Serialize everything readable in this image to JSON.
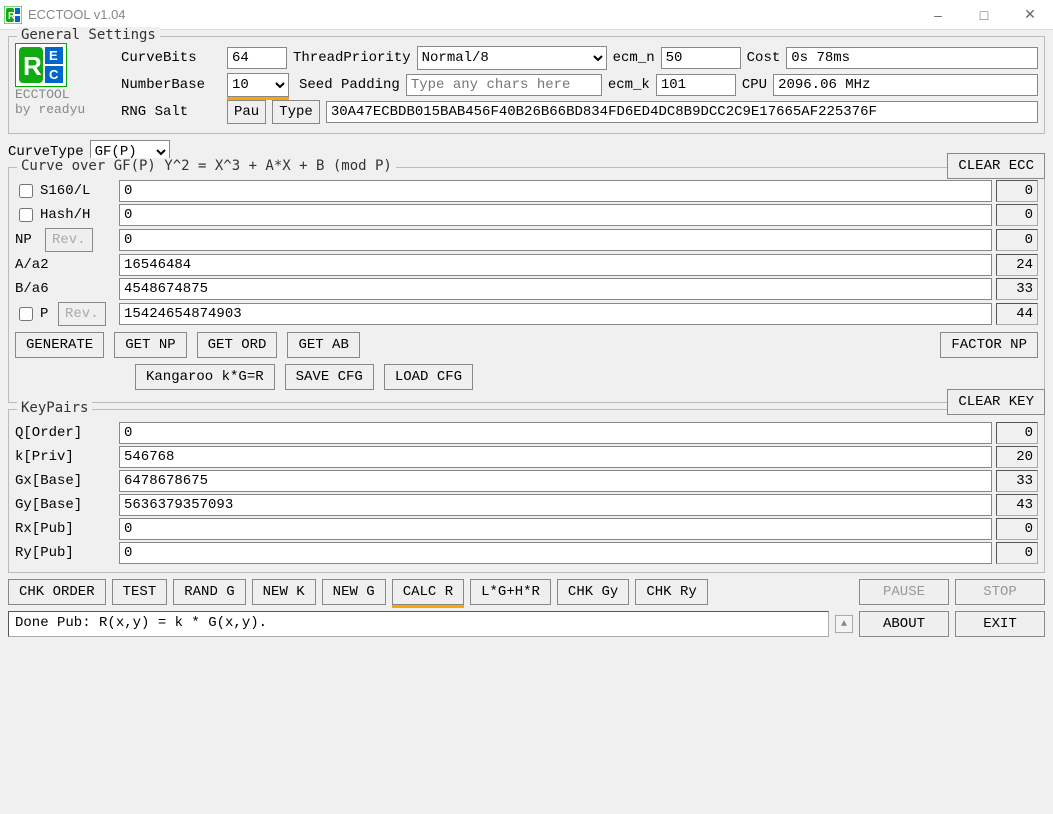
{
  "window": {
    "title": "ECCTOOL v1.04"
  },
  "logo": {
    "name": "ECCTOOL",
    "author": "by readyu"
  },
  "general": {
    "legend": "General Settings",
    "curvebits_label": "CurveBits",
    "curvebits_value": "64",
    "threadpriority_label": "ThreadPriority",
    "threadpriority_value": "Normal/8",
    "ecm_n_label": "ecm_n",
    "ecm_n_value": "50",
    "cost_label": "Cost",
    "cost_value": "0s 78ms",
    "numberbase_label": "NumberBase",
    "numberbase_value": "10",
    "seedpadding_label": "Seed Padding",
    "seedpadding_placeholder": "Type any chars here",
    "ecm_k_label": "ecm_k",
    "ecm_k_value": "101",
    "cpu_label": "CPU",
    "cpu_value": "2096.06 MHz",
    "rngsalt_label": "RNG Salt",
    "pau_btn": "Pau",
    "type_btn": "Type",
    "rngsalt_value": "30A47ECBDB015BAB456F40B26B66BD834FD6ED4DC8B9DCC2C9E17665AF225376F"
  },
  "curvetype_label": "CurveType",
  "curvetype_value": "GF(P)",
  "clear_ecc_btn": "CLEAR ECC",
  "curve": {
    "legend": "Curve over GF(P) Y^2 = X^3 + A*X + B (mod P)",
    "s160_label": "S160/L",
    "s160_value": "0",
    "s160_count": "0",
    "hash_label": "Hash/H",
    "hash_value": "0",
    "hash_count": "0",
    "np_label": "NP",
    "rev_btn": "Rev.",
    "np_value": "0",
    "np_count": "0",
    "a_label": "A/a2",
    "a_value": "16546484",
    "a_count": "24",
    "b_label": "B/a6",
    "b_value": "4548674875",
    "b_count": "33",
    "p_label": "P",
    "p_value": "15424654874903",
    "p_count": "44"
  },
  "buttons1": {
    "generate": "GENERATE",
    "get_np": "GET NP",
    "get_ord": "GET ORD",
    "get_ab": "GET AB",
    "factor_np": "FACTOR NP",
    "kangaroo": "Kangaroo k*G=R",
    "save_cfg": "SAVE CFG",
    "load_cfg": "LOAD CFG"
  },
  "clear_key_btn": "CLEAR KEY",
  "keypairs": {
    "legend": "KeyPairs",
    "q_label": "Q[Order]",
    "q_value": "0",
    "q_count": "0",
    "k_label": "k[Priv]",
    "k_value": "546768",
    "k_count": "20",
    "gx_label": "Gx[Base]",
    "gx_value": "6478678675",
    "gx_count": "33",
    "gy_label": "Gy[Base]",
    "gy_value": "5636379357093",
    "gy_count": "43",
    "rx_label": "Rx[Pub]",
    "rx_value": "0",
    "rx_count": "0",
    "ry_label": "Ry[Pub]",
    "ry_value": "0",
    "ry_count": "0"
  },
  "buttons2": {
    "chk_order": "CHK ORDER",
    "test": "TEST",
    "rand_g": "RAND G",
    "new_k": "NEW K",
    "new_g": "NEW G",
    "calc_r": "CALC R",
    "lghr": "L*G+H*R",
    "chk_gy": "CHK Gy",
    "chk_ry": "CHK Ry",
    "pause": "PAUSE",
    "stop": "STOP",
    "about": "ABOUT",
    "exit": "EXIT"
  },
  "status": "Done Pub: R(x,y) = k * G(x,y)."
}
